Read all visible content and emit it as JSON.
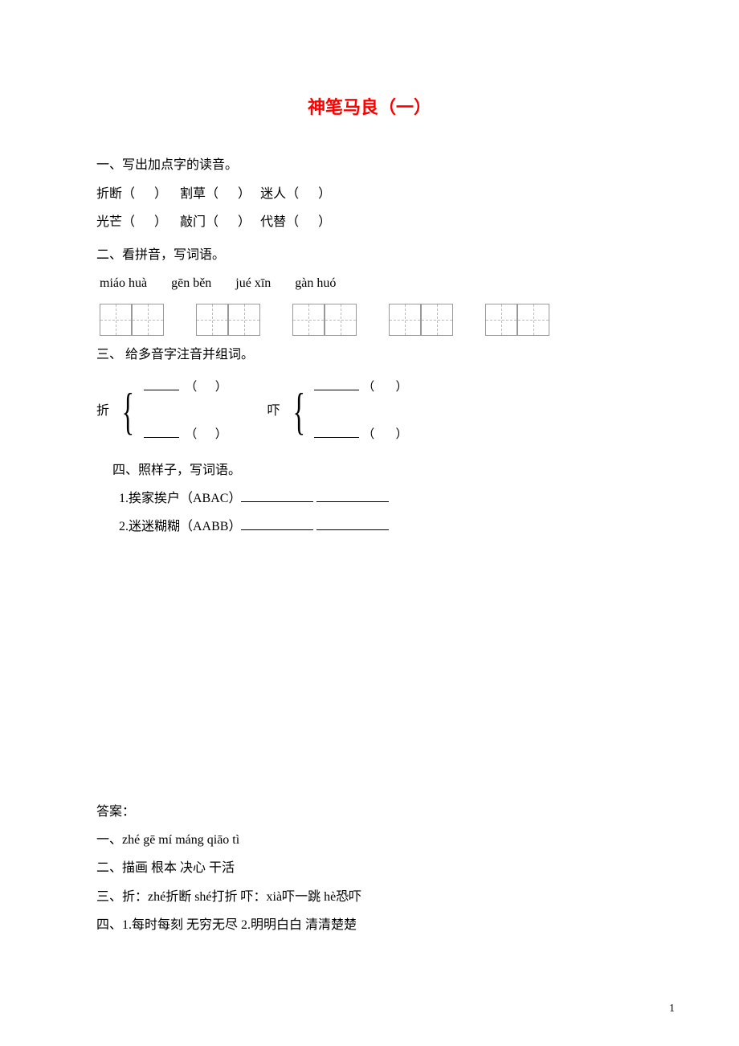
{
  "title": "神笔马良（一）",
  "section1": {
    "heading": "一、写出加点字的读音。",
    "items": [
      [
        "折断（",
        "）",
        "割草（",
        "）",
        "迷人（",
        "）"
      ],
      [
        "光芒（",
        "）",
        "敲门（",
        "）",
        "代替（",
        "）"
      ]
    ]
  },
  "section2": {
    "heading": "二、看拼音，写词语。",
    "pinyin": [
      "miáo huà",
      "gēn běn",
      "jué xīn",
      "gàn huó"
    ]
  },
  "section3": {
    "heading": "三、 给多音字注音并组词。",
    "char1": "折",
    "char2": "吓"
  },
  "section4": {
    "heading": "四、照样子，写词语。",
    "item1": "1.挨家挨户（ABAC）",
    "item2": "2.迷迷糊糊（AABB）"
  },
  "answers": {
    "heading": "答案：",
    "a1": "一、zhé gē mí máng qiāo tì",
    "a2": "二、描画 根本 决心 干活",
    "a3": "三、折：zhé折断  shé打折  吓：xià吓一跳  hè恐吓",
    "a4": "四、1.每时每刻  无穷无尽 2.明明白白   清清楚楚"
  },
  "page_number": "1"
}
